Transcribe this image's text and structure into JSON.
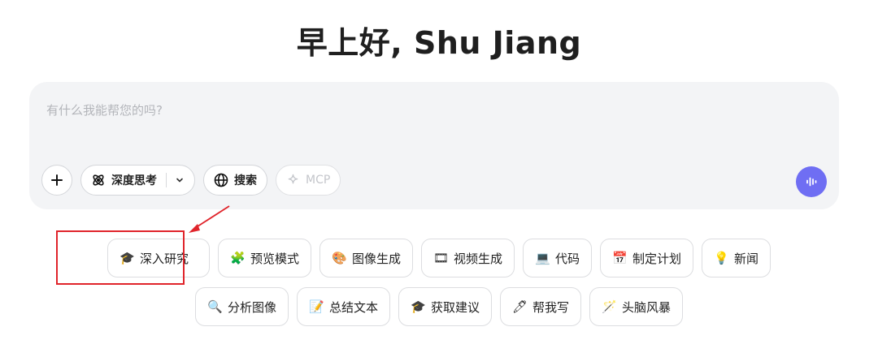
{
  "greeting": "早上好, Shu Jiang",
  "composer": {
    "placeholder": "有什么我能帮您的吗?",
    "deep_think_label": "深度思考",
    "search_label": "搜索",
    "mcp_label": "MCP"
  },
  "chips_row1": [
    {
      "icon": "🎓",
      "label": "深入研究"
    },
    {
      "icon": "🧩",
      "label": "预览模式"
    },
    {
      "icon": "🎨",
      "label": "图像生成"
    },
    {
      "icon": "🎞",
      "label": "视频生成"
    },
    {
      "icon": "💻",
      "label": "代码"
    },
    {
      "icon": "📅",
      "label": "制定计划"
    },
    {
      "icon": "💡",
      "label": "新闻"
    }
  ],
  "chips_row2": [
    {
      "icon": "🔍",
      "label": "分析图像"
    },
    {
      "icon": "📝",
      "label": "总结文本"
    },
    {
      "icon": "🎓",
      "label": "获取建议"
    },
    {
      "icon": "🖊",
      "label": "帮我写"
    },
    {
      "icon": "🪄",
      "label": "头脑风暴"
    }
  ],
  "colors": {
    "accent": "#6f6ef3",
    "annotation": "#e0242b",
    "composer_bg": "#f3f4f6"
  }
}
